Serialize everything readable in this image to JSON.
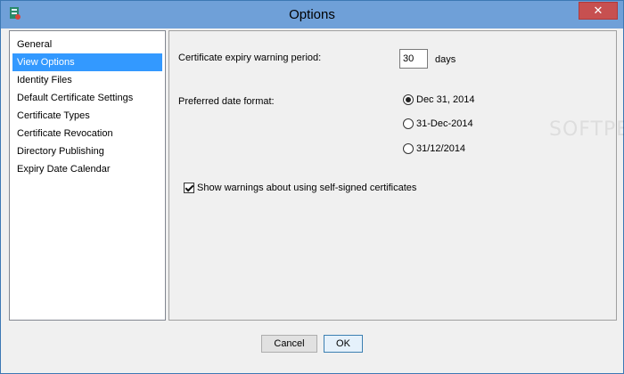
{
  "window": {
    "title": "Options",
    "close_label": "✕"
  },
  "nav": {
    "items": [
      {
        "label": "General",
        "selected": false
      },
      {
        "label": "View Options",
        "selected": true
      },
      {
        "label": "Identity Files",
        "selected": false
      },
      {
        "label": "Default Certificate Settings",
        "selected": false
      },
      {
        "label": "Certificate Types",
        "selected": false
      },
      {
        "label": "Certificate Revocation",
        "selected": false
      },
      {
        "label": "Directory Publishing",
        "selected": false
      },
      {
        "label": "Expiry Date Calendar",
        "selected": false
      }
    ]
  },
  "view_options": {
    "expiry_label": "Certificate expiry warning period:",
    "expiry_value": "30",
    "expiry_unit": "days",
    "date_format_label": "Preferred date format:",
    "date_formats": [
      {
        "label": "Dec 31, 2014",
        "checked": true
      },
      {
        "label": "31-Dec-2014",
        "checked": false
      },
      {
        "label": "31/12/2014",
        "checked": false
      }
    ],
    "self_signed_label": "Show warnings about using self-signed certificates",
    "self_signed_checked": true
  },
  "buttons": {
    "cancel": "Cancel",
    "ok": "OK"
  },
  "watermark": "SOFTPEDIA"
}
